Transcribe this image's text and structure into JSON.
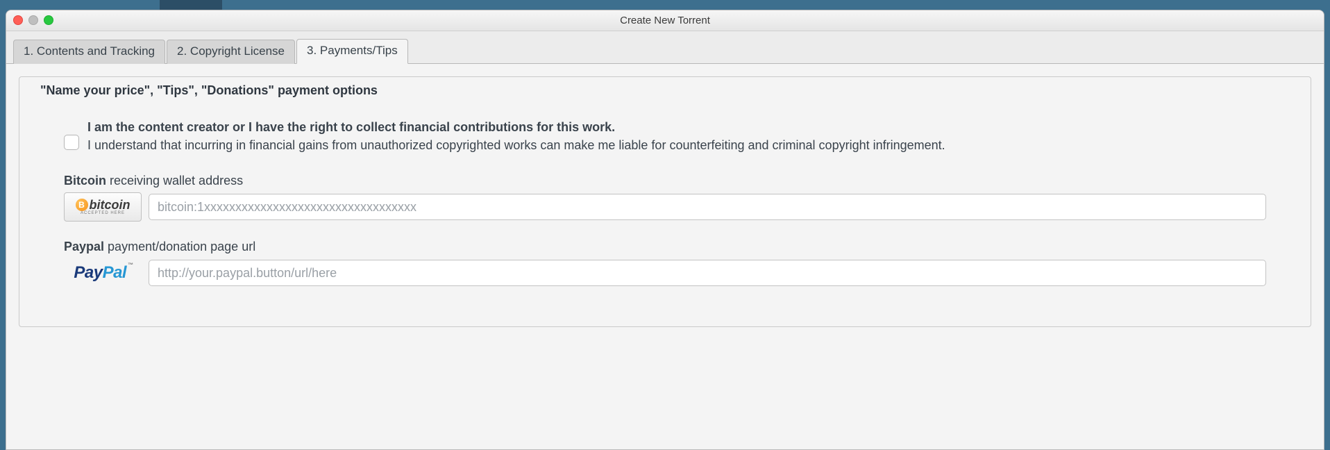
{
  "window": {
    "title": "Create New Torrent"
  },
  "tabs": [
    {
      "label": "1. Contents and Tracking"
    },
    {
      "label": "2. Copyright License"
    },
    {
      "label": "3. Payments/Tips"
    }
  ],
  "group": {
    "title": "\"Name your price\", \"Tips\", \"Donations\" payment options"
  },
  "disclaimer": {
    "bold": "I am the content creator or I have the right to collect financial contributions for this work.",
    "rest": "I understand that incurring in financial gains from unauthorized copyrighted works can make me liable for counterfeiting and criminal copyright infringement."
  },
  "bitcoin": {
    "label_strong": "Bitcoin",
    "label_rest": " receiving wallet address",
    "badge_text": "bitcoin",
    "badge_sub": "ACCEPTED HERE",
    "badge_symbol": "B",
    "placeholder": "bitcoin:1xxxxxxxxxxxxxxxxxxxxxxxxxxxxxxxxxx"
  },
  "paypal": {
    "label_strong": "Paypal",
    "label_rest": " payment/donation page url",
    "badge_pay": "Pay",
    "badge_pal": "Pal",
    "badge_tm": "™",
    "placeholder": "http://your.paypal.button/url/here"
  }
}
